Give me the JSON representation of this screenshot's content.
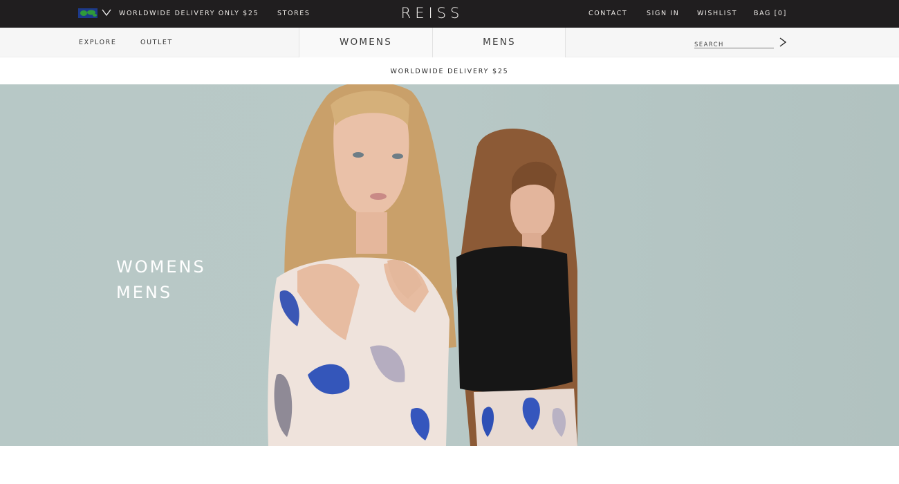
{
  "topbar": {
    "delivery": "WORLDWIDE DELIVERY ONLY $25",
    "stores": "STORES",
    "logo": "REISS",
    "contact": "CONTACT",
    "sign_in": "SIGN IN",
    "wishlist": "WISHLIST",
    "bag": "BAG [0]",
    "flag_icon": "world-flag-icon",
    "chevron_icon": "chevron-down-icon"
  },
  "subnav": {
    "explore": "EXPLORE",
    "outlet": "OUTLET",
    "tabs": [
      {
        "label": "WOMENS"
      },
      {
        "label": "MENS"
      }
    ],
    "search": {
      "placeholder": "SEARCH",
      "value": ""
    },
    "search_go_icon": "chevron-right-icon"
  },
  "promo": {
    "text": "WORLDWIDE DELIVERY $25"
  },
  "hero": {
    "links": [
      {
        "label": "WOMENS"
      },
      {
        "label": "MENS"
      }
    ],
    "background_color": "#b7c8c6"
  },
  "colors": {
    "topbar_bg": "#201e1f",
    "subnav_bg": "#f6f6f6",
    "hero_bg": "#b7c8c6"
  }
}
